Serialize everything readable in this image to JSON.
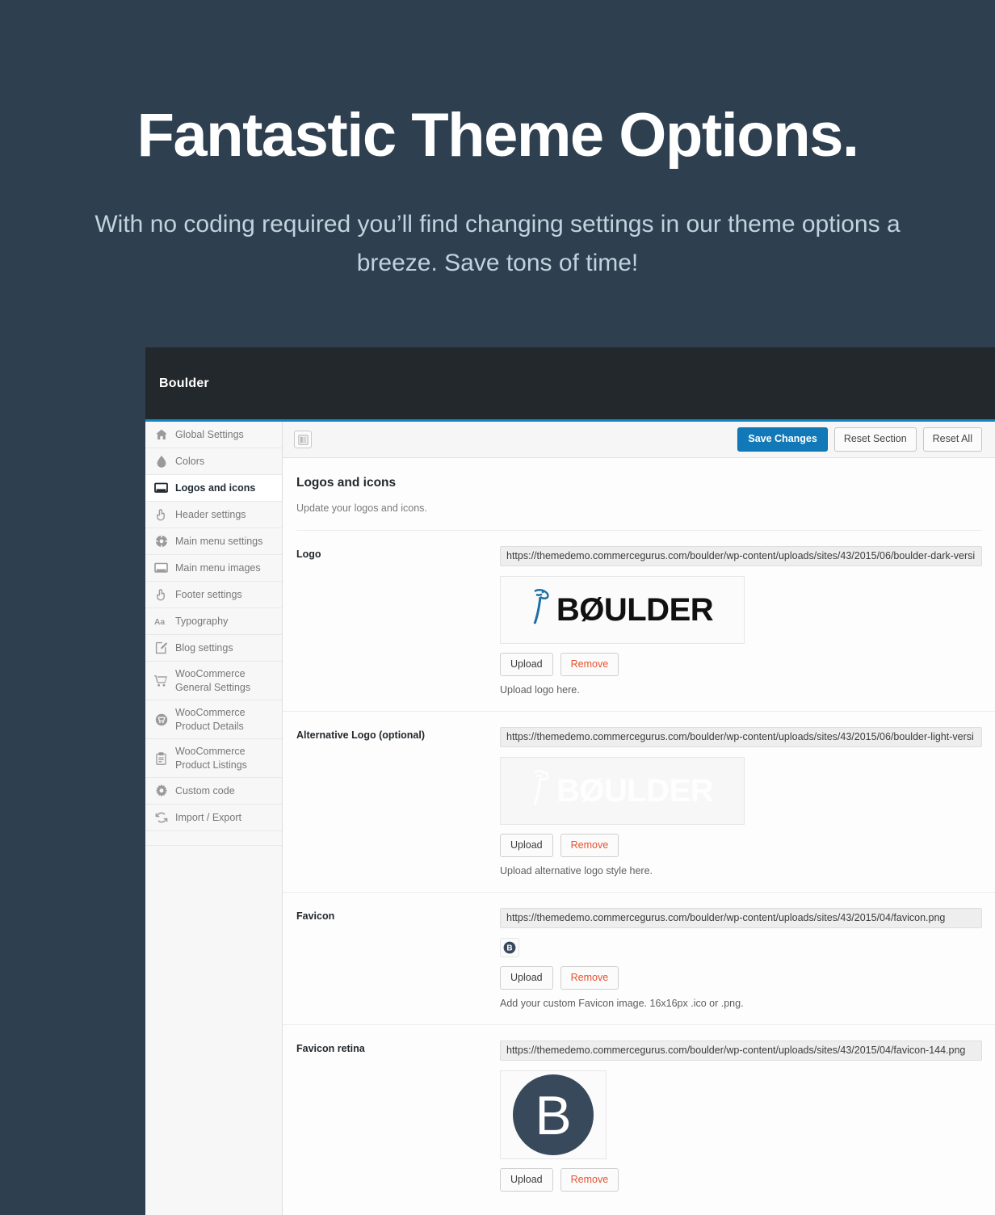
{
  "hero": {
    "title": "Fantastic Theme Options.",
    "subtitle": "With no coding required you’ll find changing settings in our theme options a breeze. Save tons of time!"
  },
  "colors": {
    "page_background": "#2e3f50",
    "panel_header_background": "#23282d",
    "accent_blue": "#0e88c8",
    "primary_button": "#1279b8",
    "remove_link": "#e8512d",
    "logo_blue": "#1f6fa5",
    "favicon_dark": "#39495c"
  },
  "panel": {
    "header_title": "Boulder"
  },
  "sidebar": {
    "items": [
      {
        "label": "Global Settings",
        "icon": "home-icon",
        "active": false
      },
      {
        "label": "Colors",
        "icon": "droplet-icon",
        "active": false
      },
      {
        "label": "Logos and icons",
        "icon": "monitor-icon",
        "active": true
      },
      {
        "label": "Header settings",
        "icon": "pointing-hand-icon",
        "active": false
      },
      {
        "label": "Main menu settings",
        "icon": "gear-circle-icon",
        "active": false
      },
      {
        "label": "Main menu images",
        "icon": "monitor-icon",
        "active": false
      },
      {
        "label": "Footer settings",
        "icon": "pointing-hand-icon",
        "active": false
      },
      {
        "label": "Typography",
        "icon": "typography-aa-icon",
        "active": false
      },
      {
        "label": "Blog settings",
        "icon": "pencil-edit-icon",
        "active": false
      },
      {
        "label": "WooCommerce General Settings",
        "icon": "shopping-cart-icon",
        "active": false
      },
      {
        "label": "WooCommerce Product Details",
        "icon": "cart-circle-icon",
        "active": false
      },
      {
        "label": "WooCommerce Product Listings",
        "icon": "clipboard-icon",
        "active": false
      },
      {
        "label": "Custom code",
        "icon": "gear-icon",
        "active": false
      },
      {
        "label": "Import / Export",
        "icon": "sync-refresh-icon",
        "active": false
      }
    ]
  },
  "toolbar": {
    "panel_toggle_icon": "panel-layout-icon",
    "save_label": "Save Changes",
    "reset_section_label": "Reset Section",
    "reset_all_label": "Reset All"
  },
  "section": {
    "title": "Logos and icons",
    "description": "Update your logos and icons."
  },
  "buttons": {
    "upload": "Upload",
    "remove": "Remove"
  },
  "fields": [
    {
      "label": "Logo",
      "url": "https://themedemo.commercegurus.com/boulder/wp-content/uploads/sites/43/2015/06/boulder-dark-versi",
      "preview": "logo-dark",
      "logo_text": "BØULDER",
      "help": "Upload logo here."
    },
    {
      "label": "Alternative Logo (optional)",
      "url": "https://themedemo.commercegurus.com/boulder/wp-content/uploads/sites/43/2015/06/boulder-light-versi",
      "preview": "logo-light",
      "logo_text": "BØULDER",
      "help": "Upload alternative logo style here."
    },
    {
      "label": "Favicon",
      "url": "https://themedemo.commercegurus.com/boulder/wp-content/uploads/sites/43/2015/04/favicon.png",
      "preview": "favicon",
      "logo_text": "B",
      "help": "Add your custom Favicon image. 16x16px .ico or .png."
    },
    {
      "label": "Favicon retina",
      "url": "https://themedemo.commercegurus.com/boulder/wp-content/uploads/sites/43/2015/04/favicon-144.png",
      "preview": "favicon-retina",
      "logo_text": "B",
      "help": ""
    }
  ]
}
